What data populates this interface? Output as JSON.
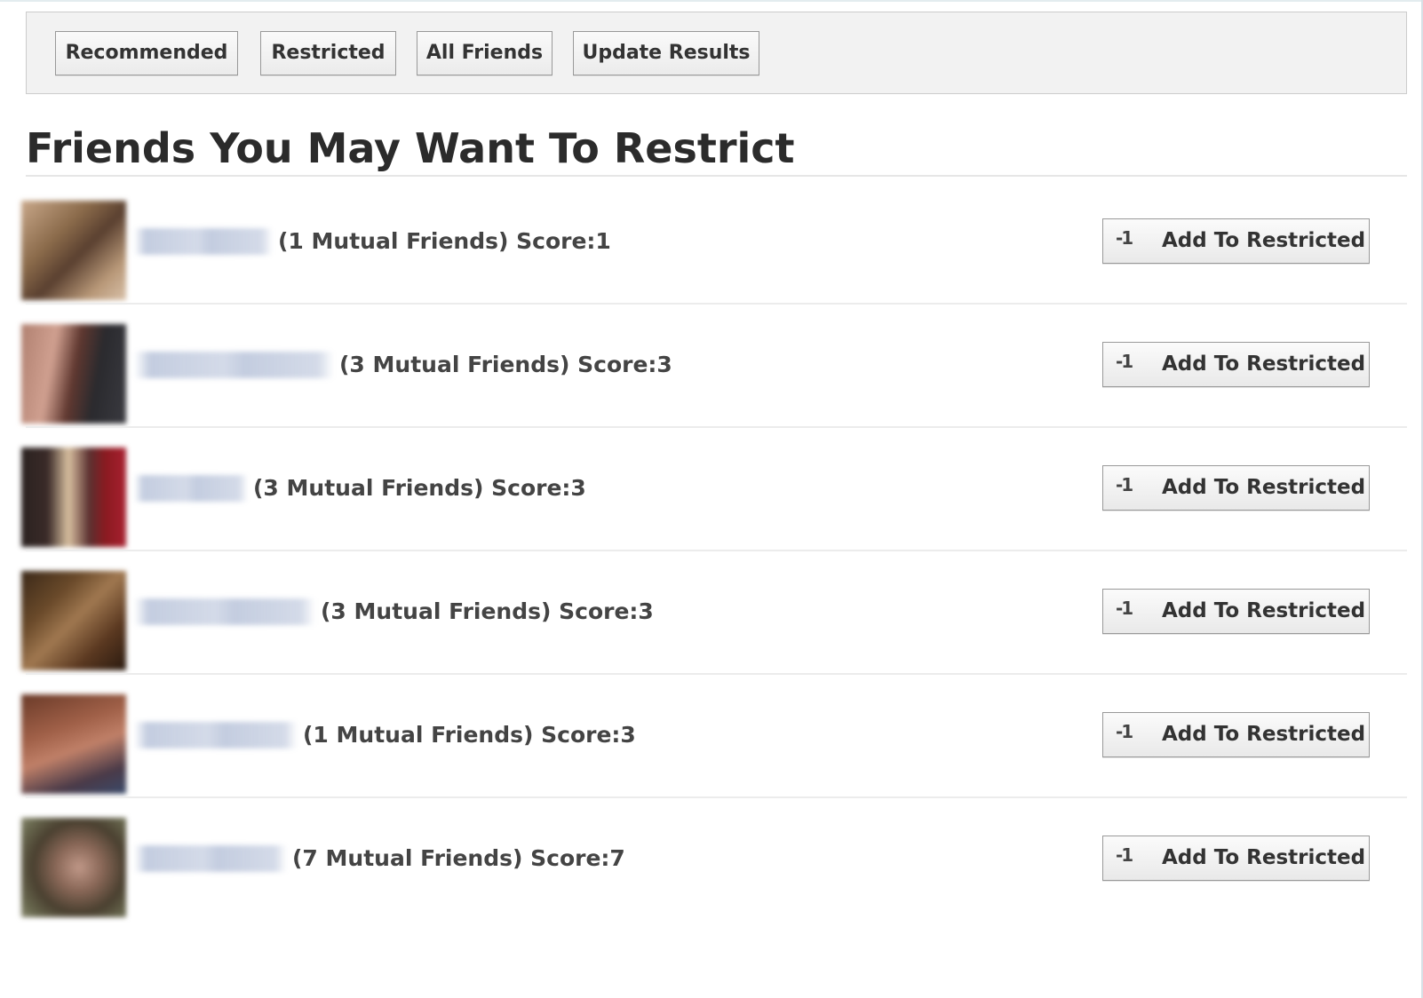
{
  "toolbar": {
    "buttons": [
      {
        "label": "Recommended"
      },
      {
        "label": "Restricted"
      },
      {
        "label": "All Friends"
      },
      {
        "label": "Update Results"
      }
    ]
  },
  "title": "Friends You May Want To Restrict",
  "friends": [
    {
      "meta": "(1 Mutual Friends) Score:1",
      "button": "Add To Restricted",
      "icon": "-1"
    },
    {
      "meta": "(3 Mutual Friends) Score:3",
      "button": "Add To Restricted",
      "icon": "-1"
    },
    {
      "meta": "(3 Mutual Friends) Score:3",
      "button": "Add To Restricted",
      "icon": "-1"
    },
    {
      "meta": "(3 Mutual Friends) Score:3",
      "button": "Add To Restricted",
      "icon": "-1"
    },
    {
      "meta": "(1 Mutual Friends) Score:3",
      "button": "Add To Restricted",
      "icon": "-1"
    },
    {
      "meta": "(7 Mutual Friends) Score:7",
      "button": "Add To Restricted",
      "icon": "-1"
    }
  ]
}
